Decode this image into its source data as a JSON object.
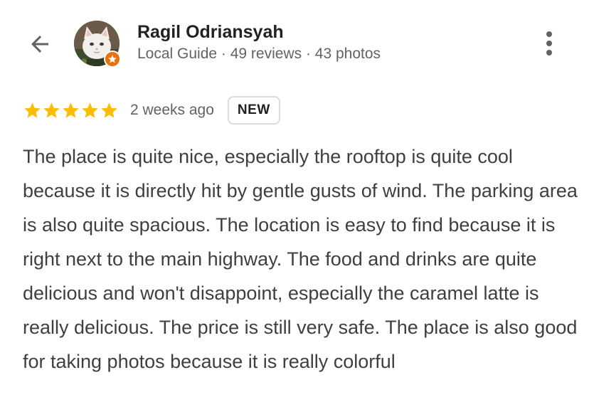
{
  "header": {
    "back_icon": "arrow-back-icon",
    "more_icon": "more-vertical-icon",
    "user": {
      "name": "Ragil Odriansyah",
      "meta": "Local Guide · 49 reviews · 43 photos",
      "avatar": "cat-photo-avatar",
      "badge_icon": "local-guide-star-icon",
      "badge_color": "#e8710a"
    }
  },
  "review": {
    "rating": 5,
    "rating_max": 5,
    "star_color": "#fbbc04",
    "time": "2 weeks ago",
    "badge": "NEW",
    "text": "The place is quite nice, especially the rooftop is quite cool because it is directly hit by gentle gusts of wind. The parking area is also quite spacious. The location is easy to find because it is right next to the main highway. The food and drinks are quite delicious and won't disappoint, especially the caramel latte is really delicious. The price is still very safe. The place is also good for taking photos because it is really colorful"
  }
}
